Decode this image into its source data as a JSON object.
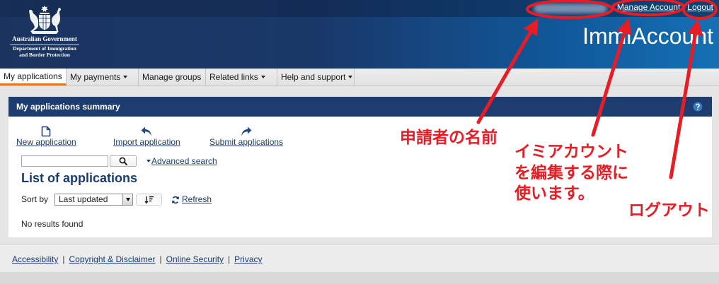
{
  "header": {
    "logo": {
      "line1": "Australian Government",
      "line2": "Department of Immigration",
      "line3": "and Border Protection",
      "icon": "coat-of-arms-icon"
    },
    "account_links": {
      "manage_account": "Manage Account",
      "logout": "Logout"
    },
    "app_title": "ImmiAccount"
  },
  "nav": {
    "items": [
      {
        "label": "My applications",
        "active": true,
        "dropdown": false
      },
      {
        "label": "My payments",
        "active": false,
        "dropdown": true
      },
      {
        "label": "Manage groups",
        "active": false,
        "dropdown": false
      },
      {
        "label": "Related links",
        "active": false,
        "dropdown": true
      },
      {
        "label": "Help and support",
        "active": false,
        "dropdown": true
      }
    ]
  },
  "summary": {
    "title": "My applications summary",
    "help_icon": "question-circle-icon",
    "actions": [
      {
        "label": "New application",
        "icon": "document-icon"
      },
      {
        "label": "Import application",
        "icon": "import-arrow-icon"
      },
      {
        "label": "Submit applications",
        "icon": "submit-arrow-icon"
      }
    ],
    "search_button_icon": "search-icon",
    "advanced_search": "Advanced search",
    "list_title": "List of applications",
    "sort": {
      "label": "Sort by",
      "selected": "Last updated",
      "direction_icon": "sort-descending-icon"
    },
    "refresh": {
      "label": "Refresh",
      "icon": "refresh-icon"
    },
    "empty_message": "No results found"
  },
  "footer": {
    "links": [
      "Accessibility",
      "Copyright & Disclaimer",
      "Online Security",
      "Privacy"
    ],
    "separator": "|"
  },
  "annotations": {
    "applicant_name": "申請者の名前",
    "manage_account_note": [
      "イミアカウント",
      "を編集する際に",
      "使います。"
    ],
    "logout_note": "ログアウト"
  },
  "colors": {
    "header_navy": "#1b345f",
    "header_blue": "#1570b4",
    "panel_header": "#1d3d70",
    "link": "#1b3d6e",
    "active_tab_underline": "#e87722",
    "help_icon": "#3a78c2",
    "annotation_red": "#e81c24"
  }
}
